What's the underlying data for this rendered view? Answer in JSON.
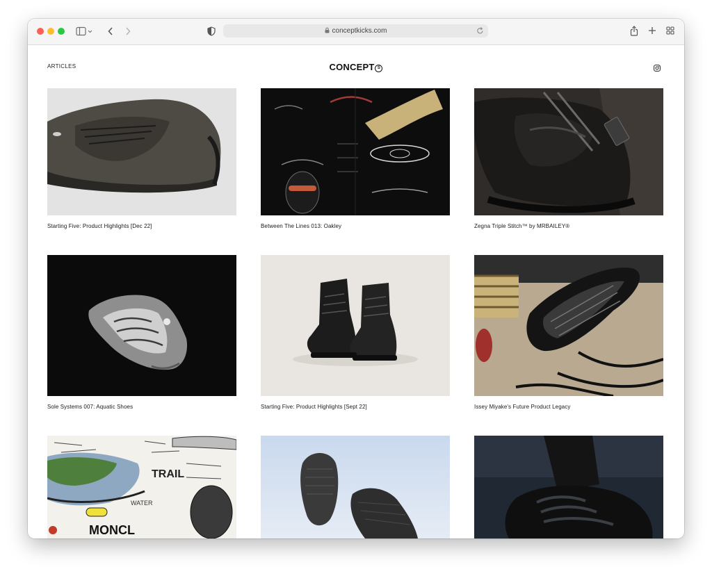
{
  "browser": {
    "url": "conceptkicks.com"
  },
  "site": {
    "nav_left": "ARTICLES",
    "brand": "CONCEPT",
    "brand_mark": "S"
  },
  "icons": {
    "sidebar": "sidebar-icon",
    "back": "chevron-left-icon",
    "forward": "chevron-right-icon",
    "privacy": "shield-icon",
    "lock": "lock-icon",
    "reload": "reload-icon",
    "share": "share-icon",
    "new_tab": "plus-icon",
    "tabs": "grid-icon",
    "instagram": "instagram-icon"
  },
  "articles": [
    {
      "title": "Starting Five: Product Highlights [Dec 22]"
    },
    {
      "title": "Between The Lines 013: Oakley"
    },
    {
      "title": "Zegna Triple Stitch™ by MRBAILEY®"
    },
    {
      "title": "Sole Systems 007: Aquatic Shoes"
    },
    {
      "title": "Starting Five: Product Highlights [Sept 22]"
    },
    {
      "title": "Issey Miyake's Future Product Legacy"
    },
    {
      "title": ""
    },
    {
      "title": ""
    },
    {
      "title": ""
    }
  ]
}
